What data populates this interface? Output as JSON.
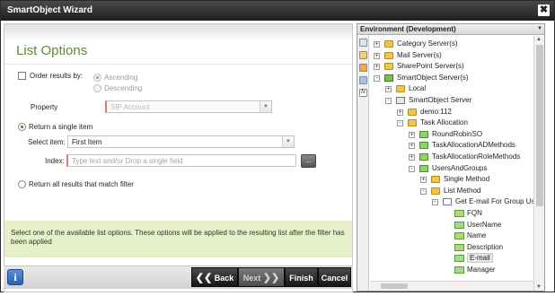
{
  "window": {
    "title": "SmartObject Wizard",
    "close_glyph": "✖"
  },
  "left": {
    "heading": "List Options",
    "order": {
      "label": "Order results by:",
      "checked": false,
      "ascending": "Ascending",
      "descending": "Descending",
      "selected": "Ascending"
    },
    "property": {
      "label": "Property",
      "placeholder": "SIP Account"
    },
    "single": {
      "label": "Return a single item",
      "selected": true
    },
    "select_item": {
      "label": "Select item:",
      "value": "First Item"
    },
    "index": {
      "label": "Index:",
      "placeholder": "Type text and/or Drop a single field",
      "button": "..."
    },
    "all": {
      "label": "Return all results that match filter"
    },
    "info": "Select one of the available list options. These options will be applied to the resulting list after the filter has been applied"
  },
  "buttons": {
    "info": "i",
    "back": "Back",
    "next": "Next",
    "finish": "Finish",
    "cancel": "Cancel",
    "back_glyph": "❮❮",
    "next_glyph": "❯❯"
  },
  "right": {
    "title": "Environment (Development)",
    "dropdown_glyph": "▼",
    "tree": [
      {
        "label": "Category Server(s)",
        "expander": "+",
        "icon": "folder"
      },
      {
        "label": "Mail Server(s)",
        "expander": "+",
        "icon": "folder"
      },
      {
        "label": "SharePoint Server(s)",
        "expander": "+",
        "icon": "folder"
      },
      {
        "label": "SmartObject Server(s)",
        "expander": "-",
        "icon": "server-green"
      },
      {
        "label": "Local",
        "expander": "+",
        "icon": "folder"
      },
      {
        "label": "SmartObject Server",
        "expander": "-",
        "icon": "server"
      },
      {
        "label": "demo:112",
        "expander": "+",
        "icon": "folder"
      },
      {
        "label": "Task Allocation",
        "expander": "-",
        "icon": "folder"
      },
      {
        "label": "RoundRobinSO",
        "expander": "+",
        "icon": "smartobject"
      },
      {
        "label": "TaskAllocationADMethods",
        "expander": "+",
        "icon": "smartobject"
      },
      {
        "label": "TaskAllocationRoleMethods",
        "expander": "+",
        "icon": "smartobject"
      },
      {
        "label": "UsersAndGroups",
        "expander": "-",
        "icon": "smartobject"
      },
      {
        "label": "Single Method",
        "expander": "+",
        "icon": "folder"
      },
      {
        "label": "List Method",
        "expander": "-",
        "icon": "folder"
      },
      {
        "label": "Get E-mail For Group Users",
        "expander": "-",
        "icon": "method"
      },
      {
        "label": "FQN",
        "expander": "",
        "icon": "property"
      },
      {
        "label": "UserName",
        "expander": "",
        "icon": "property"
      },
      {
        "label": "Name",
        "expander": "",
        "icon": "property"
      },
      {
        "label": "Description",
        "expander": "",
        "icon": "property"
      },
      {
        "label": "E-mail",
        "expander": "",
        "icon": "property",
        "selected": true
      },
      {
        "label": "Manager",
        "expander": "",
        "icon": "property"
      }
    ]
  }
}
